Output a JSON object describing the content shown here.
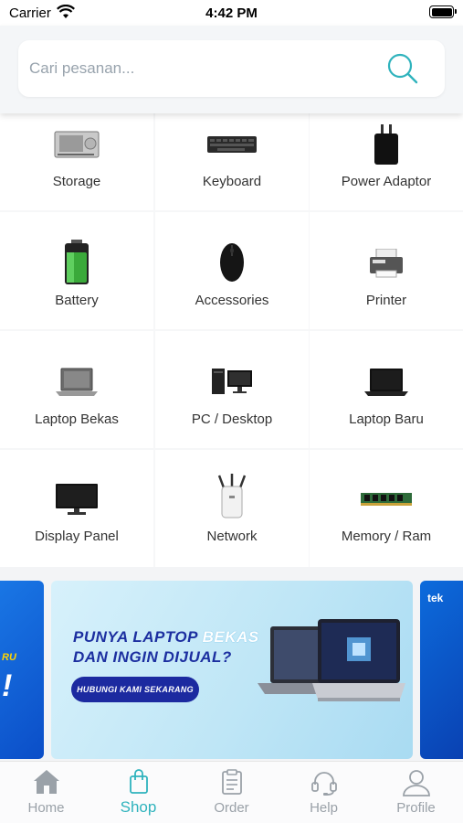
{
  "status_bar": {
    "carrier": "Carrier",
    "time": "4:42 PM"
  },
  "search": {
    "placeholder": "Cari pesanan..."
  },
  "categories": [
    {
      "label": "Storage",
      "icon": "storage-icon"
    },
    {
      "label": "Keyboard",
      "icon": "keyboard-icon"
    },
    {
      "label": "Power Adaptor",
      "icon": "power-adaptor-icon"
    },
    {
      "label": "Battery",
      "icon": "battery-icon"
    },
    {
      "label": "Accessories",
      "icon": "mouse-icon"
    },
    {
      "label": "Printer",
      "icon": "printer-icon"
    },
    {
      "label": "Laptop Bekas",
      "icon": "laptop-icon"
    },
    {
      "label": "PC / Desktop",
      "icon": "desktop-icon"
    },
    {
      "label": "Laptop Baru",
      "icon": "laptop-icon"
    },
    {
      "label": "Display Panel",
      "icon": "monitor-icon"
    },
    {
      "label": "Network",
      "icon": "router-icon"
    },
    {
      "label": "Memory / Ram",
      "icon": "ram-icon"
    }
  ],
  "banner": {
    "headline_1a": "PUNYA LAPTOP ",
    "headline_1b": "BEKAS",
    "headline_2a": "DAN INGIN ",
    "headline_2b": "DIJUAL?",
    "cta": "HUBUNGI KAMI SEKARANG",
    "left_small": "RU",
    "left_big": "!",
    "right_text": "tek"
  },
  "tabs": [
    {
      "label": "Home",
      "icon": "home-icon",
      "active": false
    },
    {
      "label": "Shop",
      "icon": "shopping-bag-icon",
      "active": true
    },
    {
      "label": "Order",
      "icon": "clipboard-icon",
      "active": false
    },
    {
      "label": "Help",
      "icon": "headset-icon",
      "active": false
    },
    {
      "label": "Profile",
      "icon": "user-icon",
      "active": false
    }
  ],
  "colors": {
    "accent": "#2fb3bd",
    "tab_inactive": "#9aa1a8",
    "banner_navy": "#1c2aa0"
  }
}
